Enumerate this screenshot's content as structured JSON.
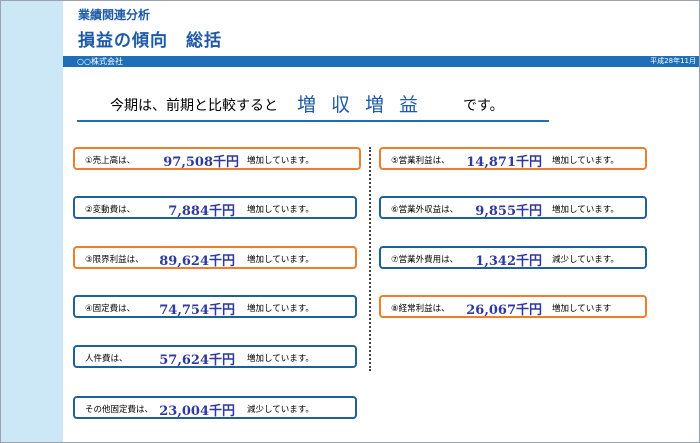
{
  "header": {
    "category": "業績関連分析",
    "title": "損益の傾向　総括",
    "company": "○○株式会社",
    "date": "平成28年11月"
  },
  "headline": {
    "pre": "今期は、前期と比較すると",
    "key": "増収増益",
    "post": "です。"
  },
  "items_left": [
    {
      "label": "①売上高は、",
      "value": "97,508千円",
      "note": "増加しています。"
    },
    {
      "label": "②変動費は、",
      "value": "7,884千円",
      "note": "増加しています。"
    },
    {
      "label": "③限界利益は、",
      "value": "89,624千円",
      "note": "増加しています。"
    },
    {
      "label": "④固定費は、",
      "value": "74,754千円",
      "note": "増加しています。"
    },
    {
      "label": "人件費は、",
      "value": "57,624千円",
      "note": "増加しています。"
    },
    {
      "label": "その他固定費は、",
      "value": "23,004千円",
      "note": "減少しています。"
    }
  ],
  "items_right": [
    {
      "label": "⑤営業利益は、",
      "value": "14,871千円",
      "note": "増加しています。"
    },
    {
      "label": "⑥営業外収益は、",
      "value": "9,855千円",
      "note": "増加しています。"
    },
    {
      "label": "⑦営業外費用は、",
      "value": "1,342千円",
      "note": "減少しています。"
    },
    {
      "label": "⑧経常利益は、",
      "value": "26,067千円",
      "note": "増加しています"
    }
  ],
  "colors": {
    "accent_blue": "#1e6fb8",
    "title_blue": "#1e5aa6",
    "highlight_orange": "#ee7d2c",
    "box_blue": "#1f5f9a",
    "value_color": "#2f3a9c",
    "side_strip": "#cce8f6"
  }
}
